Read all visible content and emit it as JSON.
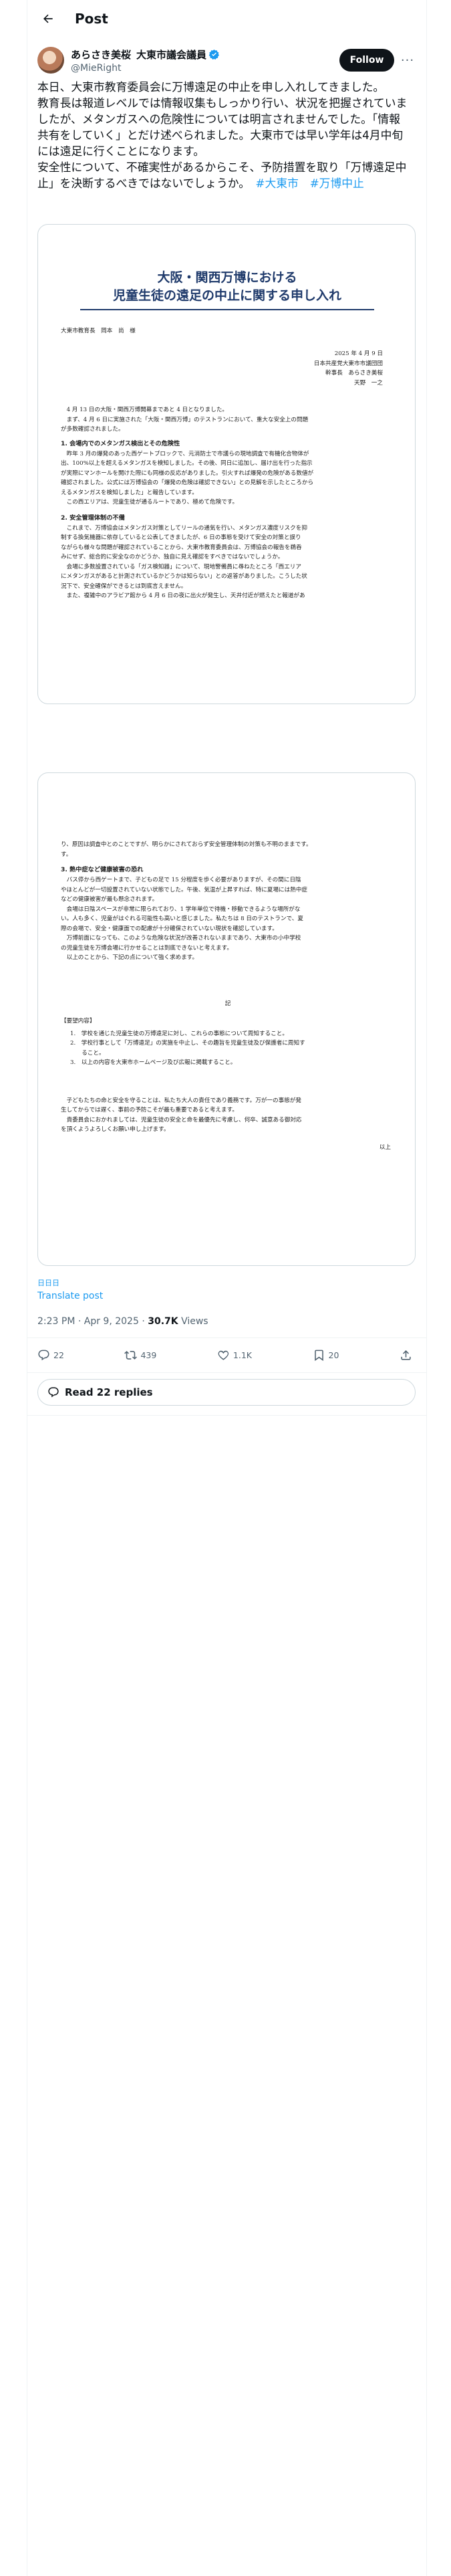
{
  "header": {
    "title": "Post"
  },
  "author": {
    "name": "あらさき美桜",
    "affiliation": "大東市議会議員",
    "handle": "@MieRight",
    "follow_label": "Follow"
  },
  "tweet": {
    "lines": [
      "本日、大東市教育委員会に万博遠足の中止を申し入れしてきました。",
      "教育長は報道レベルでは情報収集もしっかり行い、状況を把握されていま",
      "したが、メタンガスへの危険性については明言されませんでした。「情報",
      "共有をしていく」とだけ述べられました。大東市では早い学年は4月中旬",
      "には遠足に行くことになります。",
      "安全性について、不確実性があるからこそ、予防措置を取り「万博遠足中",
      "止」を決断するべきではないでしょうか。"
    ],
    "hashtags": [
      "#大東市",
      "#万博中止"
    ]
  },
  "document_page1": {
    "title_line1": "大阪・関西万博における",
    "title_line2": "児童生徒の遠足の中止に関する申し入れ",
    "addressee": "大東市教育長　岡本　尚　様",
    "date": "2025 年 4 月 9 日",
    "party": "日本共産党大東市市議団団",
    "member1": "幹事長　あらさき美桜",
    "member2": "天野　一之",
    "intro": [
      "　4 月 13 日の大阪・関西万博開幕まであと 4 日となりました。",
      "　まず、4 月 6 日に実施された「大阪・関西万博」のテストランにおいて、重大な安全上の問題",
      "が多数確認されました。"
    ],
    "section1_title": "1.  会場内でのメタンガス検出とその危険性",
    "section1": [
      "　昨年 3 月の爆発のあった西ゲートブロックで、元消防士で市議らの現地調査で有機化合物体が",
      "出、100%以上を超えるメタンガスを検知しました。その後、同日に追加し、届け出を行った指示",
      "が実際にマンホールを開けた際にも同様の反応がありました。引火すれば爆発の危険がある数値が",
      "確認されました。公式には万博協会の「爆発の危険は確認できない」との見解を示したところから",
      "えるメタンガスを検知しました」と報告しています。",
      "　この西エリアは、児童生徒が通るルートであり、極めて危険です。"
    ],
    "section2_title": "2.  安全管理体制の不備",
    "section2": [
      "　これまで、万博協会はメタンガス対策としてリールの通気を行い、メタンガス濃度リスクを抑",
      "制する換気機器に依存していると公表してきましたが、6 日の事態を受けて安全の対策と誤り",
      "ながらも様々な問題が確認されていることから、大東市教育委員会は、万博協会の報告を鵜呑",
      "みにせず、総合的に安全なのかどうか、独自に見え確認をすべきではないでしょうか。",
      "　会場に多数設置されている「ガス検知器」について、現地警備員に尋ねたところ「西エリア",
      "にメタンガスがあると計測されているかどうかは知らない」との返答がありました。こうした状",
      "況下で、安全確保ができるとは到底言えません。",
      "　また、複雑中のアラビア館から 4 月 6 日の夜に出火が発生し、天井付近が燃えたと報道があ"
    ]
  },
  "document_page2": {
    "top": [
      "り、原因は調査中とのことですが、明らかにされておらず安全管理体制の対策も不明のままです。",
      "す。"
    ],
    "section3_title": "3.  熱中症など健康被害の恐れ",
    "section3": [
      "　バス停から西ゲートまで、子どもの足で 15 分程度を歩く必要がありますが、その間に日陰",
      "やほとんどが一切設置されていない状態でした。午後、気温が上昇すれば、特に夏場には熱中症",
      "などの健康被害が最も懸念されます。",
      "　会場は日陰スペースが非常に限られており、1 学年単位で待機・移動できるような場所がな",
      "い。人も多く、児童がはぐれる可能性も高いと感じました。私たちは 8 日のテストランで、夏",
      "際の会場で、安全・健康面での配慮が十分確保されていない現状を確認しています。",
      "　万博前面になっても、このような危険な状況が改善されないままであり、大東市の小中学校",
      "の児童生徒を万博会場に行かせることは到底できないと考えます。",
      "　以上のことから、下記の点について強く求めます。"
    ],
    "ki": "記",
    "demands_title": "【要望内容】",
    "demands": [
      "1.　学校を通じた児童生徒の万博遠足に対し、これらの事態について周知すること。",
      "2.　学校行事として「万博遠足」の実施を中止し、その趣旨を児童生徒及び保護者に周知す",
      "　　ること。",
      "3.　以上の内容を大東市ホームページ及び広報に掲載すること。"
    ],
    "closing": [
      "　子どもたちの命と安全を守ることは、私たち大人の責任であり義務です。万が一の事態が発",
      "生してからでは遅く、事前の予防こそが最も重要であると考えます。",
      "　貴委員会におかれましては、児童生徒の安全と命を最優先に考慮し、何卒、誠意ある御対応",
      "を頂くようよろしくお願い申し上げます。"
    ],
    "ijo": "以上"
  },
  "lang_mark": "日日日",
  "translate_label": "Translate post",
  "meta": {
    "time": "2:23 PM · Apr 9, 2025",
    "dot": " · ",
    "views_count": "30.7K",
    "views_label": " Views"
  },
  "actions": {
    "replies": "22",
    "reposts": "439",
    "likes": "1.1K",
    "bookmarks": "20"
  },
  "read_replies_label": "Read 22 replies",
  "colors": {
    "accent": "#1d9bf0",
    "text": "#0f1419",
    "muted": "#536471",
    "doc_title": "#1f3a6b"
  }
}
